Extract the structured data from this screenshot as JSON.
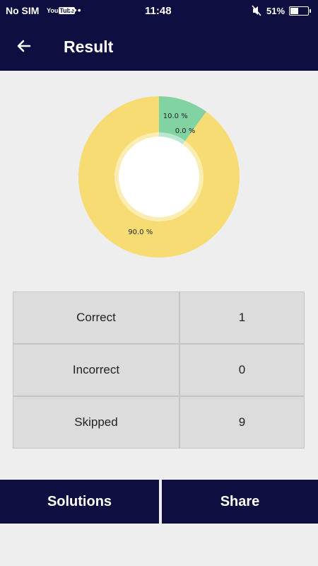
{
  "status_bar": {
    "carrier": "No SIM",
    "youtube_you": "You",
    "youtube_tube": "Tube",
    "overflow": "•••",
    "time": "11:48",
    "battery_text": "51%",
    "battery_level": 0.51,
    "icons": [
      "youtube-notification-icon",
      "more-notifications-icon",
      "muted-icon",
      "battery-icon"
    ]
  },
  "app_bar": {
    "title": "Result",
    "back_icon": "arrow-left-icon"
  },
  "chart_data": {
    "type": "pie",
    "donut": true,
    "labels": [
      "10.0 %",
      "0.0 %",
      "90.0 %"
    ],
    "values": [
      10.0,
      0.0,
      90.0
    ],
    "colors": [
      "#82d3a4",
      "#f0a830",
      "#f7dc73"
    ]
  },
  "results_table": {
    "rows": [
      {
        "label": "Correct",
        "value": "1"
      },
      {
        "label": "Incorrect",
        "value": "0"
      },
      {
        "label": "Skipped",
        "value": "9"
      }
    ]
  },
  "bottom_bar": {
    "solutions_label": "Solutions",
    "share_label": "Share"
  },
  "colors": {
    "primary": "#0e0e40",
    "background": "#eeeeee",
    "cell": "#dcdcdc"
  }
}
